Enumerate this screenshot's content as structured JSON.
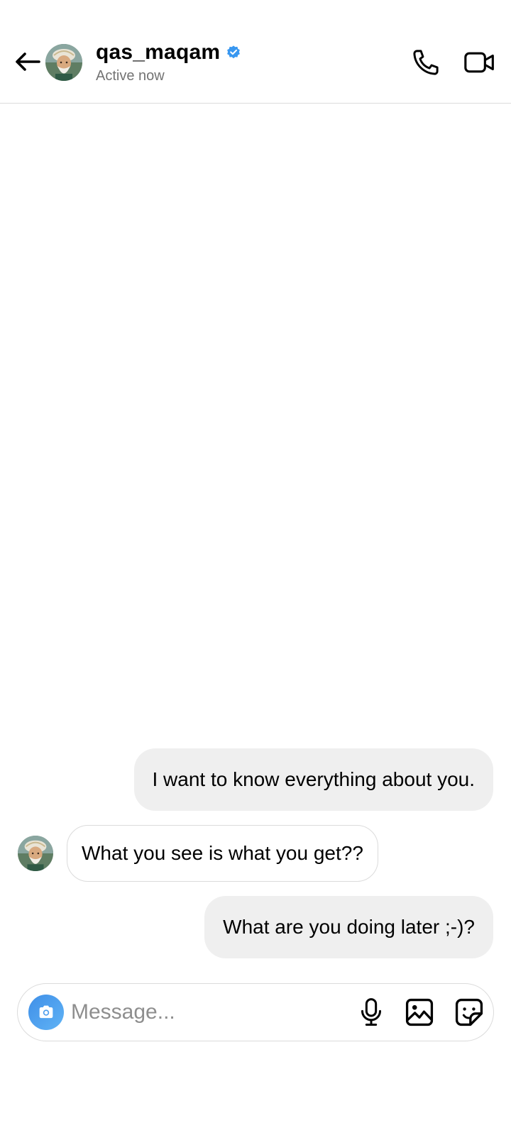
{
  "header": {
    "username": "qas_maqam",
    "status": "Active now",
    "verified": true,
    "verified_color": "#3897f0",
    "icons": {
      "back": "back-arrow-icon",
      "call": "phone-icon",
      "video": "video-camera-icon"
    }
  },
  "messages": [
    {
      "direction": "sent",
      "text": "I want to know everything about you."
    },
    {
      "direction": "received",
      "text": "What you see is what you get??"
    },
    {
      "direction": "sent",
      "text": "What are you doing later ;-)?"
    }
  ],
  "composer": {
    "placeholder": "Message...",
    "value": "",
    "icons": {
      "camera": "camera-icon",
      "mic": "microphone-icon",
      "gallery": "image-icon",
      "sticker": "sticker-icon"
    },
    "camera_color": "#3f8fe8"
  },
  "colors": {
    "sent_bubble": "#efefef",
    "received_border": "#dbdbdb",
    "muted_text": "#737373"
  }
}
